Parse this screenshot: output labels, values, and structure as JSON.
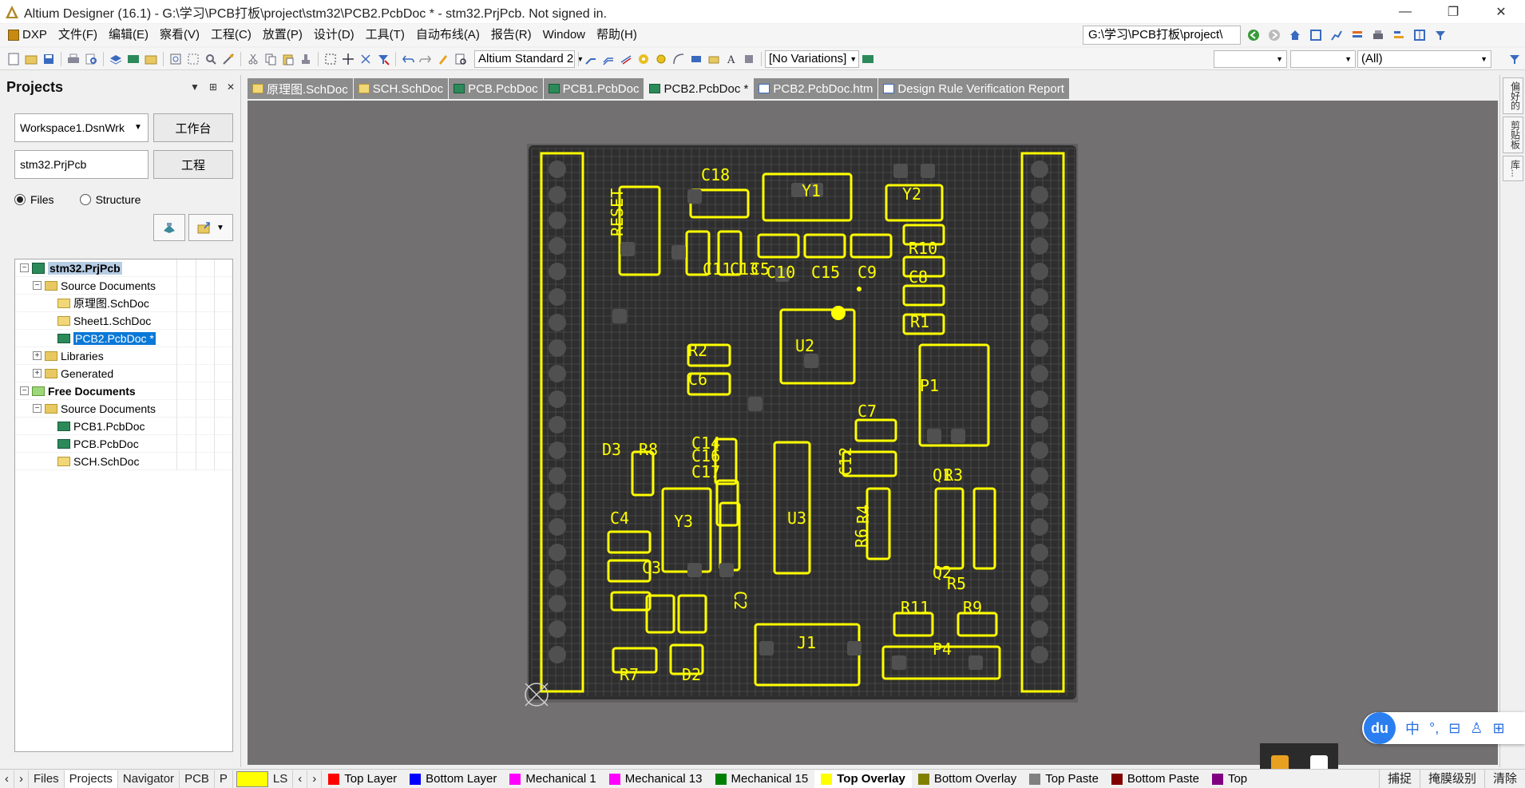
{
  "window": {
    "title": "Altium Designer (16.1) - G:\\学习\\PCB打板\\project\\stm32\\PCB2.PcbDoc * - stm32.PrjPcb. Not signed in.",
    "controls": [
      "—",
      "❐",
      "✕"
    ]
  },
  "menu": {
    "items": [
      "DXP",
      "文件(F)",
      "编辑(E)",
      "察看(V)",
      "工程(C)",
      "放置(P)",
      "设计(D)",
      "工具(T)",
      "自动布线(A)",
      "报告(R)",
      "Window",
      "帮助(H)"
    ],
    "path": "G:\\学习\\PCB打板\\project\\"
  },
  "toolbar": {
    "standard_select": "Altium Standard 2",
    "variations_select": "[No Variations]",
    "filter_select": "(All)"
  },
  "panel": {
    "title": "Projects",
    "workspace_value": "Workspace1.DsnWrk",
    "workspace_button": "工作台",
    "project_value": "stm32.PrjPcb",
    "project_button": "工程",
    "radio_files": "Files",
    "radio_structure": "Structure",
    "tree": [
      {
        "level": 0,
        "kind": "project",
        "exp": "−",
        "label": "stm32.PrjPcb"
      },
      {
        "level": 1,
        "kind": "folder",
        "exp": "−",
        "label": "Source Documents"
      },
      {
        "level": 2,
        "kind": "sch",
        "exp": "",
        "label": "原理图.SchDoc"
      },
      {
        "level": 2,
        "kind": "sch",
        "exp": "",
        "label": "Sheet1.SchDoc"
      },
      {
        "level": 2,
        "kind": "pcb",
        "exp": "",
        "label": "PCB2.PcbDoc *",
        "selected": true
      },
      {
        "level": 1,
        "kind": "folder",
        "exp": "+",
        "label": "Libraries"
      },
      {
        "level": 1,
        "kind": "folder",
        "exp": "+",
        "label": "Generated"
      },
      {
        "level": 0,
        "kind": "folder-green",
        "exp": "−",
        "label": "Free Documents",
        "bold": true
      },
      {
        "level": 1,
        "kind": "folder",
        "exp": "−",
        "label": "Source Documents"
      },
      {
        "level": 2,
        "kind": "pcb",
        "exp": "",
        "label": "PCB1.PcbDoc"
      },
      {
        "level": 2,
        "kind": "pcb",
        "exp": "",
        "label": "PCB.PcbDoc"
      },
      {
        "level": 2,
        "kind": "sch",
        "exp": "",
        "label": "SCH.SchDoc"
      }
    ]
  },
  "doc_tabs": [
    {
      "label": "原理图.SchDoc",
      "kind": "sch"
    },
    {
      "label": "SCH.SchDoc",
      "kind": "sch"
    },
    {
      "label": "PCB.PcbDoc",
      "kind": "pcb"
    },
    {
      "label": "PCB1.PcbDoc",
      "kind": "pcb"
    },
    {
      "label": "PCB2.PcbDoc *",
      "kind": "pcb",
      "active": true
    },
    {
      "label": "PCB2.PcbDoc.htm",
      "kind": "htm"
    },
    {
      "label": "Design Rule Verification Report",
      "kind": "htm"
    }
  ],
  "right_tabs": [
    "偏好的",
    "剪贴板",
    "库..."
  ],
  "pcb": {
    "components": [
      {
        "ref": "C18"
      },
      {
        "ref": "Y1"
      },
      {
        "ref": "Y2"
      },
      {
        "ref": "RESET"
      },
      {
        "ref": "C13"
      },
      {
        "ref": "C11"
      },
      {
        "ref": "C10"
      },
      {
        "ref": "C15"
      },
      {
        "ref": "C9"
      },
      {
        "ref": "R10"
      },
      {
        "ref": "C5"
      },
      {
        "ref": "C8"
      },
      {
        "ref": "R1"
      },
      {
        "ref": "U2"
      },
      {
        "ref": "R2"
      },
      {
        "ref": "C6"
      },
      {
        "ref": "P1"
      },
      {
        "ref": "C7"
      },
      {
        "ref": "D3"
      },
      {
        "ref": "R8"
      },
      {
        "ref": "C14"
      },
      {
        "ref": "C16"
      },
      {
        "ref": "C17"
      },
      {
        "ref": "C12"
      },
      {
        "ref": "C4"
      },
      {
        "ref": "Y3"
      },
      {
        "ref": "U3"
      },
      {
        "ref": "R4"
      },
      {
        "ref": "R6"
      },
      {
        "ref": "Q1"
      },
      {
        "ref": "R3"
      },
      {
        "ref": "Q2"
      },
      {
        "ref": "R5"
      },
      {
        "ref": "C3"
      },
      {
        "ref": "C2"
      },
      {
        "ref": "R11"
      },
      {
        "ref": "R9"
      },
      {
        "ref": "J1"
      },
      {
        "ref": "P4"
      },
      {
        "ref": "R7"
      },
      {
        "ref": "D2"
      }
    ]
  },
  "bottom": {
    "panel_tabs": [
      "Files",
      "Projects",
      "Navigator",
      "PCB",
      "P"
    ],
    "active_panel_tab": "Projects",
    "layer_ls": "LS",
    "layers": [
      {
        "name": "Top Layer",
        "color": "#ff0000"
      },
      {
        "name": "Bottom Layer",
        "color": "#0000ff"
      },
      {
        "name": "Mechanical 1",
        "color": "#ff00ff"
      },
      {
        "name": "Mechanical 13",
        "color": "#ff00ff"
      },
      {
        "name": "Mechanical 15",
        "color": "#008000"
      },
      {
        "name": "Top Overlay",
        "color": "#ffff00",
        "active": true
      },
      {
        "name": "Bottom Overlay",
        "color": "#808000"
      },
      {
        "name": "Top Paste",
        "color": "#808080"
      },
      {
        "name": "Bottom Paste",
        "color": "#800000"
      },
      {
        "name": "Top",
        "color": "#800080"
      }
    ],
    "status_buttons": [
      "捕捉",
      "掩膜级别",
      "清除"
    ]
  },
  "ime": {
    "logo": "du",
    "items": [
      "中",
      "°,",
      "⊟",
      "♙",
      "⊞"
    ]
  },
  "colors": {
    "overlay": "#ffff00",
    "board": "#2e2e2e",
    "workspace": "#727070",
    "selected": "#0a78d7"
  }
}
